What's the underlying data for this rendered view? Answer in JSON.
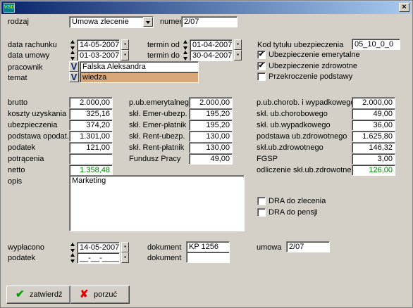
{
  "window": {
    "icon_text": "VSD",
    "close_glyph": "×"
  },
  "head": {
    "rodzaj_label": "rodzaj",
    "rodzaj_value": "Umowa zlecenie",
    "numer_label": "numer",
    "numer_value": "2/07"
  },
  "dates": {
    "data_rachunku_label": "data rachunku",
    "data_rachunku": "14-05-2007",
    "data_umowy_label": "data umowy",
    "data_umowy": "01-03-2007",
    "termin_od_label": "termin od",
    "termin_od": "01-04-2007",
    "termin_do_label": "termin do",
    "termin_do": "30-04-2007",
    "cal_glyph": "▪"
  },
  "pracownik": {
    "label": "pracownik",
    "value": "Falska Aleksandra"
  },
  "temat": {
    "label": "temat",
    "value": "wiedza"
  },
  "v_glyph": "V",
  "insurance": {
    "kod_label": "Kod tytułu ubezpieczenia",
    "kod_value": "05_10_0_0",
    "emerytalne": "Ubezpieczenie emerytalne",
    "zdrowotne": "Ubezpieczenie zdrowotne",
    "przekroczenie": "Przekroczenie podstawy",
    "check": "✔"
  },
  "left_fields": [
    {
      "label": "brutto",
      "value": "2.000,00"
    },
    {
      "label": "koszty uzyskania",
      "value": "325,16"
    },
    {
      "label": "ubezpieczenia",
      "value": "374,20"
    },
    {
      "label": "podstawa opodat.",
      "value": "1.301,00"
    },
    {
      "label": "podatek",
      "value": "121,00"
    },
    {
      "label": "potrącenia",
      "value": ""
    },
    {
      "label": "netto",
      "value": "1.358,48"
    }
  ],
  "mid_fields": [
    {
      "label": "p.ub.emerytalnego",
      "value": "2.000,00"
    },
    {
      "label": "skł. Emer-ubezp.",
      "value": "195,20"
    },
    {
      "label": "skł. Emer-płatnik",
      "value": "195,20"
    },
    {
      "label": "skł. Rent-ubezp.",
      "value": "130,00"
    },
    {
      "label": "skł. Rent-płatnik",
      "value": "130,00"
    },
    {
      "label": "Fundusz Pracy",
      "value": "49,00"
    }
  ],
  "right_fields": [
    {
      "label": "p.ub.chorob. i wypadkowego",
      "value": "2.000,00"
    },
    {
      "label": "skł. ub.chorobowego",
      "value": "49,00"
    },
    {
      "label": "skł. ub.wypadkowego",
      "value": "36,00"
    },
    {
      "label": "podstawa ub.zdrowotnego",
      "value": "1.625,80"
    },
    {
      "label": "skł.ub.zdrowotnego",
      "value": "146,32"
    },
    {
      "label": "FGSP",
      "value": "3,00"
    },
    {
      "label": "odliczenie skł.ub.zdrowotnego",
      "value": "126,00"
    }
  ],
  "opis": {
    "label": "opis",
    "value": "Marketing"
  },
  "dra": {
    "zlecenia": "DRA do zlecenia",
    "pensji": "DRA do pensji"
  },
  "bottom": {
    "wyplacono_label": "wypłacono",
    "wyplacono_value": "14-05-2007",
    "podatek_label": "podatek",
    "podatek_value": "__-__-____",
    "dokument_label": "dokument",
    "dokument1_value": "KP 1256",
    "dokument2_value": "",
    "umowa_label": "umowa",
    "umowa_value": "2/07"
  },
  "buttons": {
    "zatwierdz": "zatwierdź",
    "zatwierdz_icon": "✔",
    "porzuc": "porzuć",
    "porzuc_icon": "✘"
  },
  "colors": {
    "title_start": "#0a246a",
    "title_end": "#a6caf0",
    "temat_bg": "#d8a77a",
    "green_text": "#008000",
    "cancel_red": "#e00000",
    "ok_green": "#00a000"
  }
}
